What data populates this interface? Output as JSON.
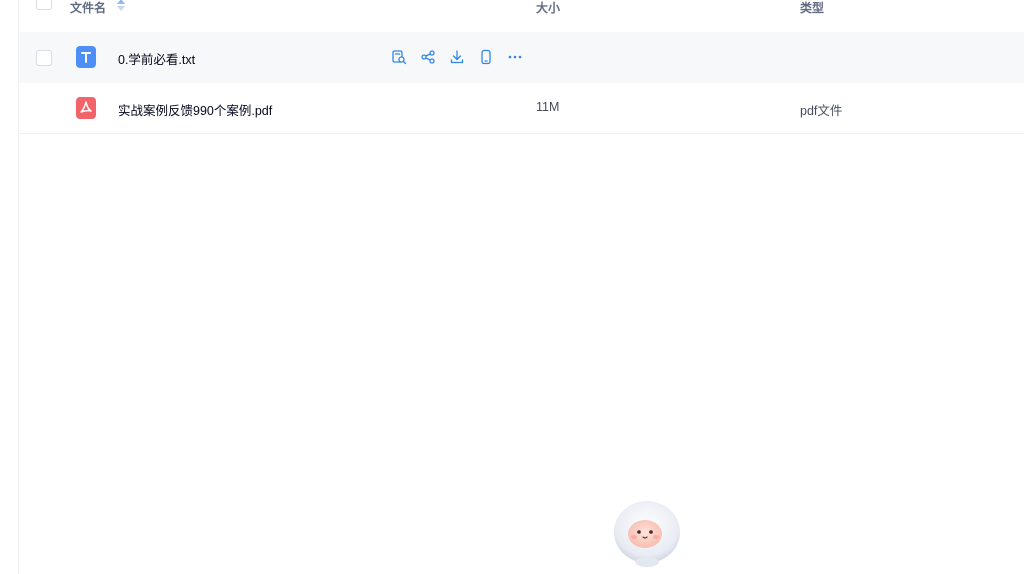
{
  "header": {
    "name_label": "文件名",
    "size_label": "大小",
    "type_label": "类型"
  },
  "files": [
    {
      "name": "0.学前必看.txt",
      "size": "",
      "type": "",
      "icon": "txt-file-icon",
      "hovered": true
    },
    {
      "name": "实战案例反馈990个案例.pdf",
      "size": "11M",
      "type": "pdf文件",
      "icon": "pdf-file-icon",
      "hovered": false
    }
  ],
  "row_actions": [
    "preview-icon",
    "share-icon",
    "download-icon",
    "mobile-icon",
    "more-icon"
  ],
  "colors": {
    "accent": "#3b82f6",
    "txt_icon": "#4d8ff7",
    "pdf_icon": "#f2646a",
    "hover_row": "#f7f8fa"
  }
}
